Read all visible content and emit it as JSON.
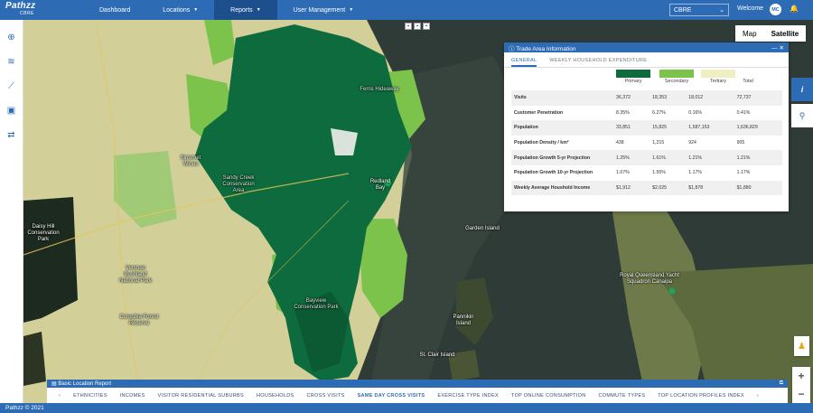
{
  "app": {
    "logo": "Pathzz",
    "logo_sub": "CBRE"
  },
  "nav": {
    "dashboard": "Dashboard",
    "locations": "Locations",
    "reports": "Reports",
    "user_management": "User Management"
  },
  "header": {
    "company": "CBRE",
    "welcome": "Welcome",
    "avatar_initials": "MC"
  },
  "map": {
    "map_label": "Map",
    "satellite_label": "Satellite",
    "places": {
      "daisy_hill": "Daisy Hill Conservation Park",
      "venman": "Venman Bushland National Park",
      "cornubia": "Cornubia Forest Reserve",
      "bayview": "Bayview Conservation Park",
      "garden_island": "Garden Island",
      "pannikin": "Pannikin Island",
      "st_clair": "St. Clair Island",
      "royal_qld": "Royal Queensland Yacht Squadron Canaipa",
      "redland_bay": "Redland Bay",
      "sandy_creek": "Sandy Creek Conservation Area",
      "sirromet": "Sirromet Wines",
      "ferns_hideaway": "Ferns Hideaway"
    }
  },
  "panel": {
    "title": "Trade Area Information",
    "tabs": [
      "GENERAL",
      "WEEKLY HOUSEHOLD EXPENDITURE"
    ],
    "legend": [
      {
        "label": "Primary",
        "color": "#0e6b3d"
      },
      {
        "label": "Secondary",
        "color": "#7cc34b"
      },
      {
        "label": "Tertiary",
        "color": "#efefc2"
      }
    ],
    "total_label": "Total",
    "rows": [
      {
        "label": "Visits",
        "values": [
          "36,372",
          "18,353",
          "18,012",
          "72,737"
        ]
      },
      {
        "label": "Customer Penetration",
        "values": [
          "8.35%",
          "6.27%",
          "0.16%",
          "0.41%"
        ]
      },
      {
        "label": "Population",
        "values": [
          "33,851",
          "15,825",
          "1,587,153",
          "1,636,829"
        ]
      },
      {
        "label": "Population Density / km²",
        "values": [
          "438",
          "1,215",
          "924",
          "905"
        ]
      },
      {
        "label": "Population Growth 5-yr Projection",
        "values": [
          "1.25%",
          "1.61%",
          "1.21%",
          "1.21%"
        ]
      },
      {
        "label": "Population Growth 10-yr Projection",
        "values": [
          "1.07%",
          "1.55%",
          "1.17%",
          "1.17%"
        ]
      },
      {
        "label": "Weekly Average Houshold Income",
        "values": [
          "$1,912",
          "$2,025",
          "$1,878",
          "$1,880"
        ]
      }
    ]
  },
  "report": {
    "title": "Basic Location Report",
    "tabs": [
      "ETHNICITIES",
      "INCOMES",
      "VISITOR RESIDENTIAL SUBURBS",
      "HOUSEHOLDS",
      "CROSS VISITS",
      "SAME DAY CROSS VISITS",
      "EXERCISE TYPE INDEX",
      "TOP ONLINE CONSUMPTION",
      "COMMUTE TYPES",
      "TOP LOCATION PROFILES INDEX"
    ]
  },
  "footer": "Pathzz © 2021"
}
